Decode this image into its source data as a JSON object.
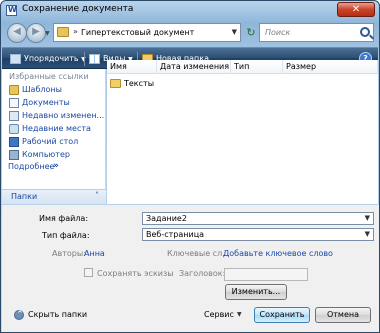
{
  "window": {
    "title": "Сохранение документа"
  },
  "titlebar": {
    "close_glyph": "✕"
  },
  "address": {
    "path": "Гипертекстовый документ",
    "search_placeholder": "Поиск"
  },
  "toolbar": {
    "organize": "Упорядочить",
    "views": "Виды",
    "new_folder": "Новая папка"
  },
  "sidebar": {
    "title": "Избранные ссылки",
    "items": [
      {
        "label": "Шаблоны",
        "icon": "folder-icon"
      },
      {
        "label": "Документы",
        "icon": "documents-icon"
      },
      {
        "label": "Недавно изменен...",
        "icon": "recent-icon"
      },
      {
        "label": "Недавние места",
        "icon": "places-icon"
      },
      {
        "label": "Рабочий стол",
        "icon": "desktop-icon"
      },
      {
        "label": "Компьютер",
        "icon": "computer-icon"
      }
    ],
    "more": "Подробнее",
    "folders": "Папки"
  },
  "files": {
    "columns": [
      "Имя",
      "Дата изменения",
      "Тип",
      "Размер"
    ],
    "rows": [
      {
        "name": "Тексты"
      }
    ]
  },
  "form": {
    "filename_label": "Имя файла:",
    "filename_value": "Задание2",
    "filetype_label": "Тип файла:",
    "filetype_value": "Веб-страница",
    "authors_label": "Авторы:",
    "authors_value": "Анна",
    "keywords_label": "Ключевые сл...",
    "keywords_value": "Добавьте ключевое слово",
    "thumbs_label": "Сохранять эскизы",
    "title_label": "Заголовок:",
    "change_button": "Изменить..."
  },
  "footer": {
    "hide_folders": "Скрыть папки",
    "tools": "Сервис",
    "save": "Сохранить",
    "cancel": "Отмена"
  }
}
